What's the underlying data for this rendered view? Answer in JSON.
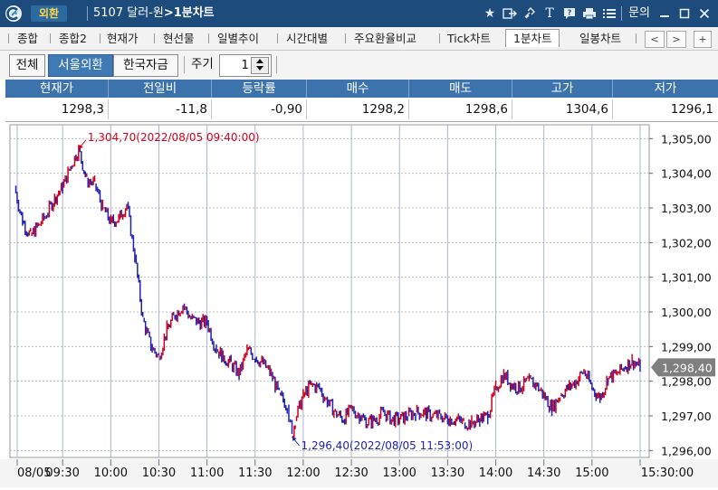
{
  "titlebar": {
    "badge": "외환",
    "code": "5107",
    "name": "달러-원",
    "arrow": ">",
    "view": "1분차트",
    "inquiry": "문의",
    "icons": [
      "star-icon",
      "export-icon",
      "link-icon",
      "text-icon",
      "help-icon",
      "print-icon",
      "list-icon",
      "minimize-icon",
      "maximize-icon",
      "close-icon"
    ]
  },
  "tabs": {
    "items": [
      "종합",
      "종합2",
      "현재가",
      "현선물",
      "일별추이",
      "시간대별",
      "주요환율비교",
      "Tick차트",
      "1분차트",
      "일봉차트"
    ],
    "active": "1분차트",
    "nav_prev": "<",
    "nav_next": ">",
    "nav_add": "+"
  },
  "filters": {
    "segments": [
      "전체",
      "서울외환",
      "한국자금"
    ],
    "active_segment": "서울외환",
    "period_label": "주기",
    "period_value": "1"
  },
  "quote": {
    "headers": [
      "현재가",
      "전일비",
      "등락률",
      "매수",
      "매도",
      "고가",
      "저가"
    ],
    "values": [
      "1298,3",
      "-11,8",
      "-0,90",
      "1298,2",
      "1298,6",
      "1304,6",
      "1296,1"
    ]
  },
  "chart_data": {
    "type": "line",
    "x_tick_labels": [
      "08/05",
      "09:30",
      "10:00",
      "10:30",
      "11:00",
      "11:30",
      "12:00",
      "12:30",
      "13:00",
      "13:30",
      "14:00",
      "14:30",
      "15:00",
      "15:30:00"
    ],
    "y_tick_labels": [
      "1,305,00",
      "1,304,00",
      "1,303,00",
      "1,302,00",
      "1,301,00",
      "1,300,00",
      "1,299,00",
      "1,298,00",
      "1,297,00",
      "1,296,00"
    ],
    "ylim": [
      1295.8,
      1305.4
    ],
    "grid": true,
    "current_price_label": "1,298,40",
    "current_price": 1298.4,
    "max_annotation": "1,304,70(2022/08/05 09:40:00)",
    "min_annotation": "1,296,40(2022/08/05 11:53:00)",
    "max_point": {
      "x": "09:40",
      "y": 1304.7
    },
    "min_point": {
      "x": "11:53",
      "y": 1296.4
    },
    "colors": {
      "up": "#d0021b",
      "down": "#1e22b4",
      "grid": "#9aa0b0",
      "price_tag": "#7f7f7f"
    },
    "series": [
      {
        "x": [
          "09:00",
          "09:05",
          "09:10",
          "09:15",
          "09:20",
          "09:25",
          "09:30",
          "09:35",
          "09:40",
          "09:45",
          "09:50",
          "09:55",
          "10:00",
          "10:05",
          "10:10",
          "10:15",
          "10:20",
          "10:25",
          "10:30",
          "10:35",
          "10:40",
          "10:45",
          "10:50",
          "10:55",
          "11:00",
          "11:05",
          "11:10",
          "11:15",
          "11:20",
          "11:25",
          "11:30",
          "11:35",
          "11:40",
          "11:45",
          "11:50",
          "11:53",
          "11:55",
          "12:00",
          "12:05",
          "12:10",
          "12:15",
          "12:20",
          "12:25",
          "12:30",
          "12:35",
          "12:40",
          "12:45",
          "12:50",
          "12:55",
          "13:00",
          "13:05",
          "13:10",
          "13:15",
          "13:20",
          "13:25",
          "13:30",
          "13:35",
          "13:40",
          "13:45",
          "13:50",
          "13:55",
          "14:00",
          "14:05",
          "14:10",
          "14:15",
          "14:20",
          "14:25",
          "14:30",
          "14:35",
          "14:40",
          "14:45",
          "14:50",
          "14:55",
          "15:00",
          "15:05",
          "15:10",
          "15:15",
          "15:20",
          "15:25",
          "15:30"
        ],
        "values": [
          1303.6,
          1302.6,
          1302.2,
          1302.5,
          1302.8,
          1303.3,
          1303.6,
          1304.2,
          1304.7,
          1303.8,
          1303.7,
          1303.0,
          1302.6,
          1302.7,
          1303.1,
          1301.6,
          1299.8,
          1299.0,
          1298.7,
          1299.5,
          1299.9,
          1300.2,
          1299.8,
          1299.7,
          1299.7,
          1299.0,
          1298.7,
          1298.5,
          1298.2,
          1298.9,
          1298.7,
          1298.5,
          1298.2,
          1297.6,
          1297.3,
          1296.4,
          1296.9,
          1297.6,
          1297.9,
          1297.8,
          1297.4,
          1297.1,
          1296.9,
          1297.2,
          1297.0,
          1296.8,
          1296.9,
          1297.1,
          1296.9,
          1296.9,
          1297.0,
          1297.1,
          1297.1,
          1297.0,
          1297.0,
          1296.9,
          1296.9,
          1296.8,
          1296.8,
          1296.9,
          1297.0,
          1297.8,
          1298.2,
          1297.9,
          1297.8,
          1298.0,
          1297.9,
          1297.6,
          1297.2,
          1297.6,
          1297.8,
          1298.0,
          1298.3,
          1297.8,
          1297.5,
          1298.1,
          1298.2,
          1298.4,
          1298.6,
          1298.4
        ]
      }
    ]
  }
}
